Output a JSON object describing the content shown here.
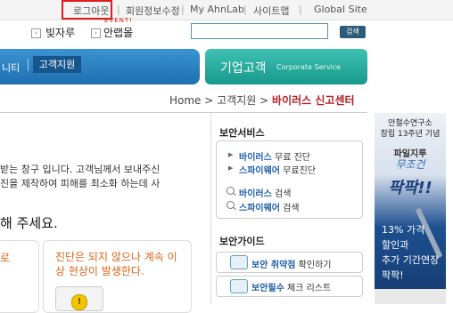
{
  "topbar": {
    "logout": "로그아웃",
    "event": "EVENT!",
    "edit_member": "회원정보수정",
    "my_ahnlab": "My AhnLab",
    "sitemap": "사이트맵",
    "global_site": "Global Site"
  },
  "row2": {
    "link1": "빛자루",
    "link2": "안랩몰",
    "search_button": "검색",
    "search_value": ""
  },
  "nav": {
    "left_partial": "니티",
    "support_tab": "고객지원",
    "corp_ko": "기업고객",
    "corp_en": "Corporate Service"
  },
  "breadcrumb": {
    "home": "Home",
    "sep": ">",
    "support": "고객지원",
    "current": "바이러스 신고센터"
  },
  "main": {
    "text_line1": "받는 창구 입니다. 고객님께서 보내주신",
    "text_line2": "진을 제작하여 피해를 최소화 하는데 사",
    "subhead": "해 주세요.",
    "card1_text": "로",
    "card2_text": "진단은 되지 않으나 계속 이상 현상이 발생한다."
  },
  "sidebar": {
    "service_title": "보안서비스",
    "services": [
      {
        "hl": "바이러스",
        "rest": " 무료 진단"
      },
      {
        "hl": "스파이웨어",
        "rest": " 무료진단"
      },
      {
        "hl": "바이러스",
        "rest": " 검색"
      },
      {
        "hl": "스파이웨어",
        "rest": " 검색"
      }
    ],
    "guide_title": "보안가이드",
    "guides": [
      {
        "hl": "보안 취약점",
        "rest": " 확인하기"
      },
      {
        "hl": "보안필수",
        "rest": " 체크 리스트"
      }
    ]
  },
  "banner": {
    "line1": "안철수연구소",
    "line2": "창립 13주년 기념",
    "line3": "파일지루",
    "line4": "무조건",
    "line5": "팍팍!!",
    "line6": "13% 가격",
    "line7": "할인과",
    "line8": "추가 기간연장",
    "line9": "팍팍!"
  },
  "colors": {
    "nav_blue": "#1f6fb0",
    "nav_green": "#17988a",
    "highlight_red": "#e21b1b",
    "breadcrumb_current": "#b31f27",
    "link_blue": "#1f5fa8",
    "warn_orange": "#e0641b"
  }
}
